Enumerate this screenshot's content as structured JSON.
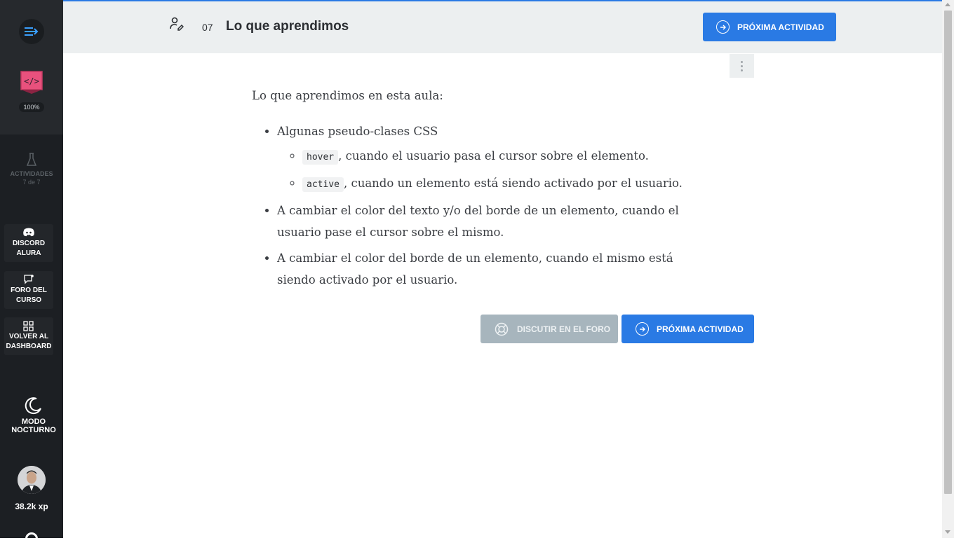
{
  "sidebar": {
    "menu_icon": "menu-arrow-icon",
    "course_icon": "html-code-icon",
    "progress": "100%",
    "activities": {
      "label": "ACTIVIDADES",
      "count": "7 de 7"
    },
    "links": [
      {
        "label": "DISCORD ALURA",
        "icon": "discord-icon"
      },
      {
        "label": "FORO DEL CURSO",
        "icon": "chat-icon"
      },
      {
        "label": "VOLVER AL DASHBOARD",
        "icon": "dashboard-icon"
      }
    ],
    "night_mode": {
      "label": "MODO NOCTURNO",
      "icon": "moon-icon"
    },
    "user": {
      "xp": "38.2k xp"
    }
  },
  "header": {
    "lesson_number": "07",
    "lesson_title": "Lo que aprendimos",
    "next_button": "PRÓXIMA ACTIVIDAD"
  },
  "content": {
    "intro": "Lo que aprendimos en esta aula:",
    "item1": "Algunas pseudo-clases CSS",
    "sub1_code": "hover",
    "sub1_text": ", cuando el usuario pasa el cursor sobre el elemento.",
    "sub2_code": "active",
    "sub2_text": ", cuando un elemento está siendo activado por el usuario.",
    "item2": "A cambiar el color del texto y/o del borde de un elemento, cuando el usuario pase el cursor sobre el mismo.",
    "item3": "A cambiar el color del borde de un elemento, cuando el mismo está siendo activado por el usuario."
  },
  "actions": {
    "forum_button": "DISCUTIR EN EL FORO",
    "next_button": "PRÓXIMA ACTIVIDAD"
  },
  "colors": {
    "primary": "#2a7ae4",
    "sidebar_bg": "#1c1f23",
    "header_bg": "#eceff0",
    "forum_button": "#a7b5bd"
  }
}
